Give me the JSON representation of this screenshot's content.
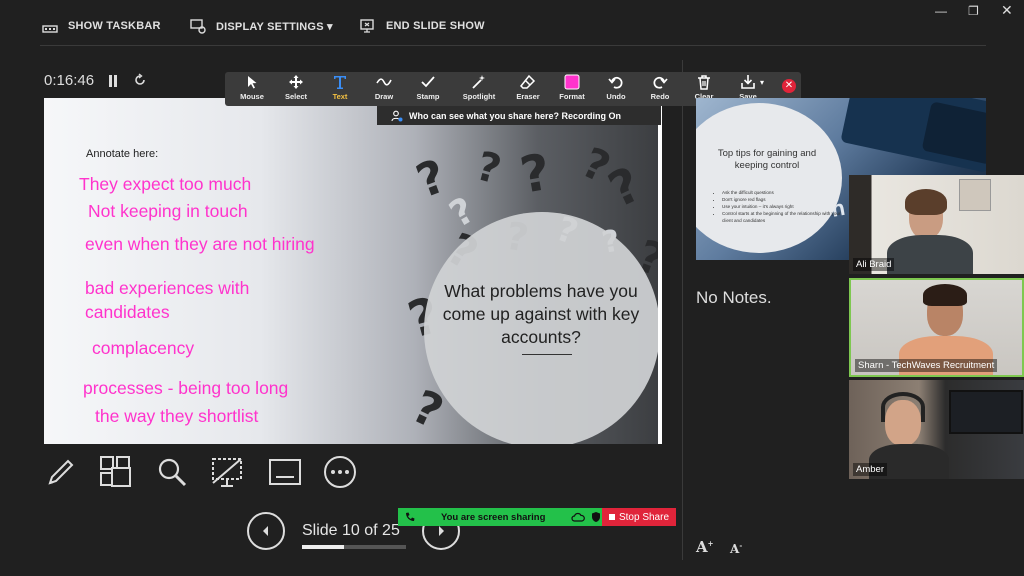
{
  "topbar": {
    "show_taskbar": "SHOW TASKBAR",
    "display_settings": "DISPLAY SETTINGS ▾",
    "end_slide_show": "END SLIDE SHOW"
  },
  "presenter": {
    "timer": "0:16:46",
    "slide_counter": "Slide 10 of 25",
    "progress_fraction": 0.4
  },
  "annotation_toolbar": {
    "tools": [
      {
        "label": "Mouse",
        "icon": "mouse-pointer-icon"
      },
      {
        "label": "Select",
        "icon": "move-icon"
      },
      {
        "label": "Text",
        "icon": "text-icon"
      },
      {
        "label": "Draw",
        "icon": "draw-icon"
      },
      {
        "label": "Stamp",
        "icon": "stamp-check-icon"
      },
      {
        "label": "Spotlight",
        "icon": "spotlight-wand-icon"
      },
      {
        "label": "Eraser",
        "icon": "eraser-icon"
      },
      {
        "label": "Format",
        "icon": "format-color-icon"
      },
      {
        "label": "Undo",
        "icon": "undo-icon"
      },
      {
        "label": "Redo",
        "icon": "redo-icon"
      },
      {
        "label": "Clear",
        "icon": "trash-icon"
      },
      {
        "label": "Save",
        "icon": "save-download-icon"
      }
    ],
    "format_color": "#ff33cc",
    "text_color": "#3a8ef6",
    "who_can_see": "Who can see what you share here? Recording On"
  },
  "slide": {
    "annotate_label": "Annotate here:",
    "question": "What problems have you come up against with key accounts?",
    "annotations": [
      "They expect too much",
      "Not keeping in touch",
      "even when they are not hiring",
      "bad experiences with",
      "candidates",
      "complacency",
      "processes - being too long",
      "the way they shortlist"
    ],
    "ink_color": "#ff33cc"
  },
  "next_slide": {
    "title": "Top tips for gaining and keeping control",
    "bullets": [
      "Ask the difficult questions",
      "Don't ignore red flags",
      "Use your intuition – it's always right",
      "Control starts at the beginning of the relationship with your client and candidates"
    ],
    "bg_word": "con"
  },
  "notes": {
    "text": "No Notes."
  },
  "participants": [
    {
      "name": "Ali Braid"
    },
    {
      "name": "Sharn - TechWaves Recruitment"
    },
    {
      "name": "Amber"
    }
  ],
  "share": {
    "status": "You are screen sharing",
    "stop_label": "Stop Share",
    "green": "#23c14a",
    "red": "#e0243a"
  }
}
